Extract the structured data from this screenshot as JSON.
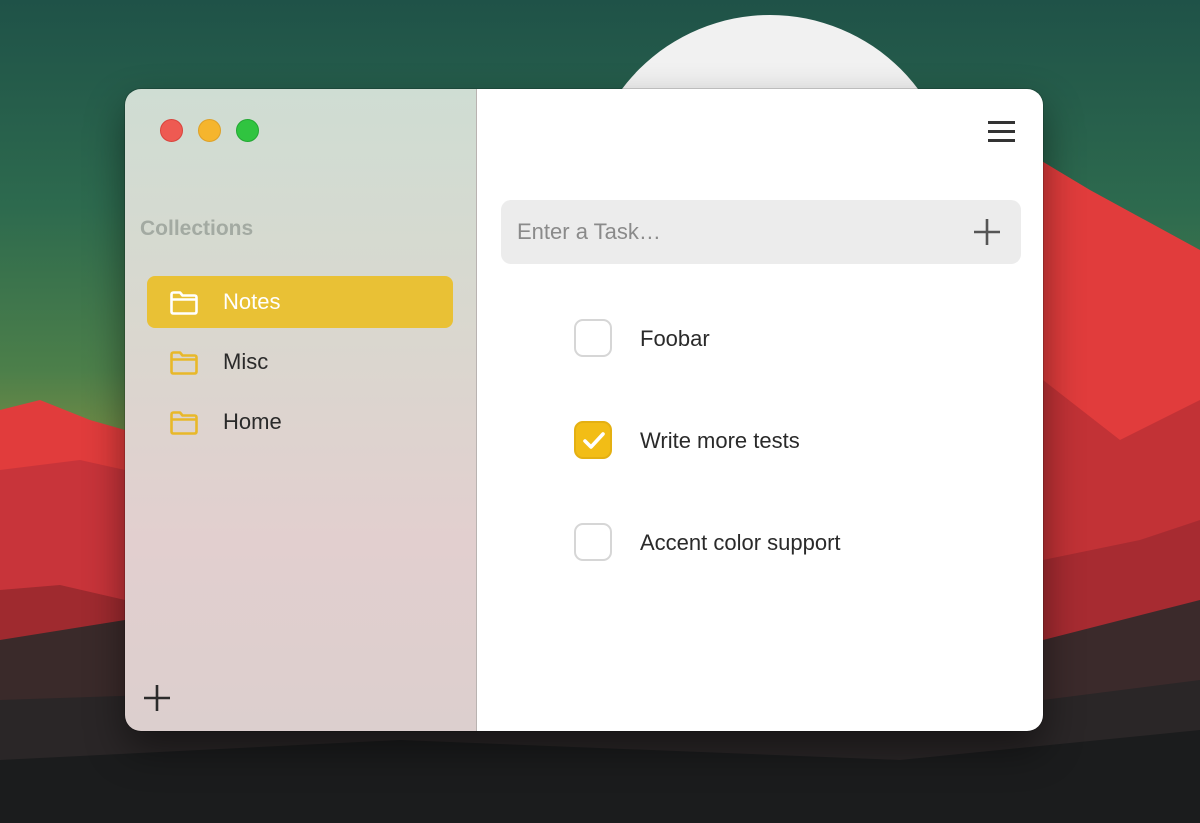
{
  "desktop": {
    "wallpaper": "mountain-landscape",
    "colors": {
      "sky_top": "#23574a",
      "sky_mid": "#3f7a4e",
      "sky_low": "#9b9b3f",
      "sun": "#f2f2f2",
      "mountain_red": "#e13c3c",
      "mountain_dark_red": "#b02c30",
      "ground_dark": "#1f1f1f"
    }
  },
  "window": {
    "traffic_lights": {
      "close": "#ee5a52",
      "minimize": "#f5b52d",
      "maximize": "#30c440"
    },
    "sidebar": {
      "heading": "Collections",
      "items": [
        {
          "label": "Notes",
          "icon": "folder-icon",
          "selected": true
        },
        {
          "label": "Misc",
          "icon": "folder-icon",
          "selected": false
        },
        {
          "label": "Home",
          "icon": "folder-icon",
          "selected": false
        }
      ],
      "add_icon": "plus-icon"
    },
    "main": {
      "menu_icon": "hamburger-menu-icon",
      "task_input": {
        "placeholder": "Enter a Task…",
        "value": "",
        "add_icon": "plus-icon"
      },
      "tasks": [
        {
          "label": "Foobar",
          "checked": false
        },
        {
          "label": "Write more tests",
          "checked": true
        },
        {
          "label": "Accent color support",
          "checked": false
        }
      ]
    },
    "accent_color": "#f2bd16"
  }
}
